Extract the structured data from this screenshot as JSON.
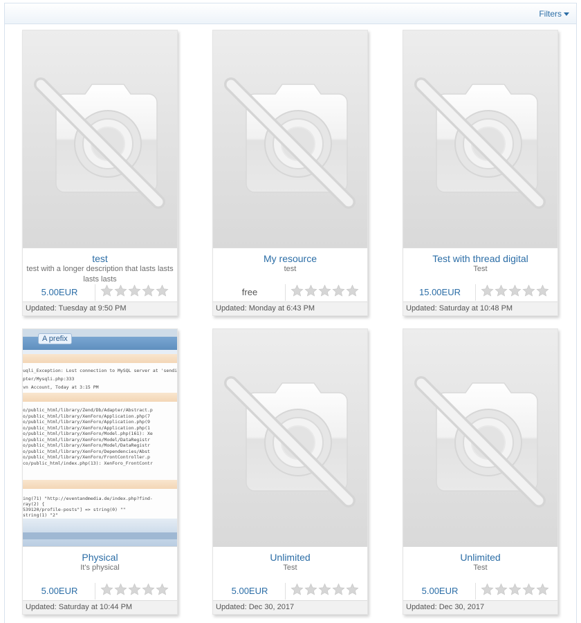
{
  "filter_bar": {
    "label": "Filters"
  },
  "resources": [
    {
      "title": "test",
      "description": "test with a longer description that lasts lasts lasts lasts",
      "price": "5.00EUR",
      "rating": 0,
      "updated": "Updated: Tuesday at 9:50 PM",
      "thumbnail": "camera-off-icon"
    },
    {
      "title": "My resource",
      "description": "test",
      "price": "free",
      "rating": 0,
      "updated": "Updated: Monday at 6:43 PM",
      "thumbnail": "camera-off-icon"
    },
    {
      "title": "Test with thread digital",
      "description": "Test",
      "price": "15.00EUR",
      "rating": 0,
      "updated": "Updated: Saturday at 10:48 PM",
      "thumbnail": "camera-off-icon"
    },
    {
      "title": "Physical",
      "description": "It's physical",
      "price": "5.00EUR",
      "rating": 0,
      "updated": "Updated: Saturday at 10:44 PM",
      "thumbnail": "screenshot",
      "screenshot": {
        "prefix": "A prefix",
        "lines_top": [
          "uqli_Exception: Lost connection to MySQL server at 'sending aut",
          "pter/Mysqli.php:333",
          "vn Account, Today at 3:15 PM"
        ],
        "lines_stack": [
          "o/public_html/library/Zend/Db/Adapter/Abstract.p",
          "o/public_html/library/XenForo/Application.php(7",
          "o/public_html/library/XenForo/Application.php(9",
          "o/public_html/library/XenForo/Application.php(1",
          "o/public_html/library/XenForo/Model.php(161): Xe",
          "o/public_html/library/XenForo/Model/DataRegistr",
          "o/public_html/library/XenForo/Model/DataRegistr",
          "o/public_html/library/XenForo/Dependencies/Abst",
          "o/public_html/library/XenForo/FrontController.p",
          "co/public_html/index.php(13): XenForo_FrontContr"
        ],
        "lines_bottom": [
          "ing(71) \"http://eventandmedia.de/index.php?find-",
          "ray(2) {",
          "539120/profile-posts\"] => string(0) \"\"",
          "string(1) \"2\""
        ]
      }
    },
    {
      "title": "Unlimited",
      "description": "Test",
      "price": "5.00EUR",
      "rating": 0,
      "updated": "Updated: Dec 30, 2017",
      "thumbnail": "camera-off-icon"
    },
    {
      "title": "Unlimited",
      "description": "Test",
      "price": "5.00EUR",
      "rating": 0,
      "updated": "Updated: Dec 30, 2017",
      "thumbnail": "camera-off-icon"
    }
  ],
  "colors": {
    "link": "#2b6da6",
    "star_empty": "#d4d4d4",
    "footer_bg": "#f1f1f1"
  }
}
